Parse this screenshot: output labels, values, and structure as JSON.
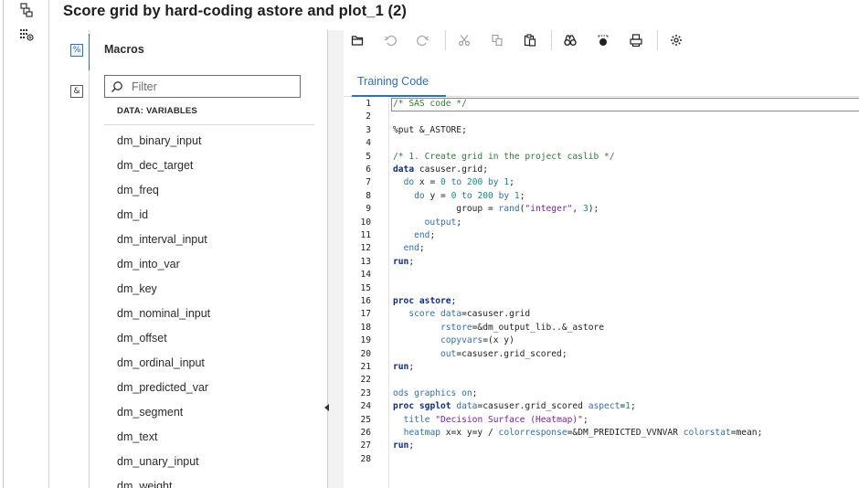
{
  "window": {
    "title": "Score grid by hard-coding astore and plot_1 (2)"
  },
  "rail": {
    "icons": [
      "flow-toggle-icon",
      "variables-grid-icon"
    ]
  },
  "macros_panel": {
    "tabs": [
      {
        "symbol": "%",
        "name": "macros-tab"
      },
      {
        "symbol": "&",
        "name": "variables-tab"
      }
    ],
    "title": "Macros",
    "filter_placeholder": "Filter",
    "section_label": "DATA: VARIABLES",
    "items": [
      "dm_binary_input",
      "dm_dec_target",
      "dm_freq",
      "dm_id",
      "dm_interval_input",
      "dm_into_var",
      "dm_key",
      "dm_nominal_input",
      "dm_offset",
      "dm_ordinal_input",
      "dm_predicted_var",
      "dm_segment",
      "dm_text",
      "dm_unary_input",
      "dm_weight"
    ]
  },
  "toolbar": {
    "buttons": [
      "open-icon",
      "undo-icon",
      "redo-icon",
      "cut-icon",
      "copy-icon",
      "paste-icon",
      "find-icon",
      "clear-icon",
      "print-icon",
      "settings-icon"
    ]
  },
  "editor": {
    "tab_label": "Training Code",
    "lines": [
      "/* SAS code */",
      "",
      "%put &_ASTORE;",
      "",
      "/* 1. Create grid in the project caslib */",
      "data casuser.grid;",
      "  do x = 0 to 200 by 1;",
      "    do y = 0 to 200 by 1;",
      "            group = rand(\"integer\", 3);",
      "      output;",
      "    end;",
      "  end;",
      "run;",
      "",
      "",
      "proc astore;",
      "   score data=casuser.grid",
      "         rstore=&dm_output_lib..&_astore",
      "         copyvars=(x y)",
      "         out=casuser.grid_scored;",
      "run;",
      "",
      "ods graphics on;",
      "proc sgplot data=casuser.grid_scored aspect=1;",
      "  title \"Decision Surface (Heatmap)\";",
      "  heatmap x=x y=y / colorresponse=&DM_PREDICTED_VVNVAR colorstat=mean;",
      "run;",
      ""
    ],
    "colors": {
      "comment": "#2e7d32",
      "keyword": "#0b2c8e",
      "option": "#2f6fb3",
      "string": "#7b1fa2",
      "number": "#0a8f8f",
      "accent": "#2f6fb3"
    }
  }
}
